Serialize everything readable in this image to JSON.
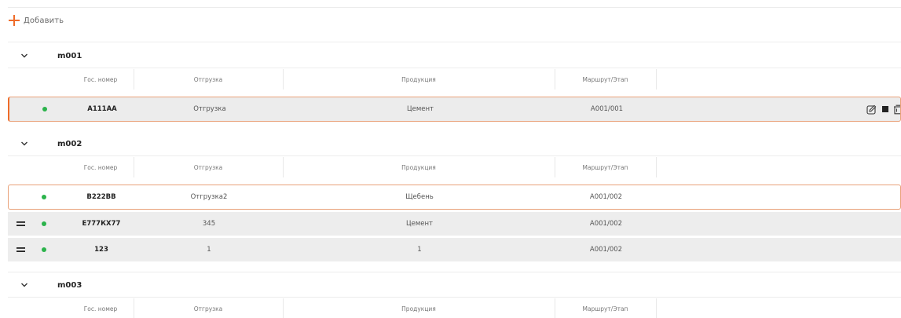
{
  "toolbar": {
    "add_label": "Добавить",
    "accent_color": "#ef6c2a"
  },
  "columns": [
    "Гос. номер",
    "Отгрузка",
    "Продукция",
    "Маршрут/Этап"
  ],
  "groups": [
    {
      "name": "m001",
      "rows": [
        {
          "plate": "А111АА",
          "shipment": "Отгрузка",
          "product": "Цемент",
          "route": "A001/001",
          "status": "green"
        }
      ]
    },
    {
      "name": "m002",
      "rows": [
        {
          "plate": "В222ВВ",
          "shipment": "Отгрузка2",
          "product": "Щебень",
          "route": "A001/002",
          "status": "green"
        },
        {
          "plate": "Е777КХ77",
          "shipment": "345",
          "product": "Цемент",
          "route": "A001/002",
          "status": "green"
        },
        {
          "plate": "123",
          "shipment": "1",
          "product": "1",
          "route": "A001/002",
          "status": "green"
        }
      ]
    },
    {
      "name": "m003",
      "rows": []
    }
  ],
  "icons": {
    "add": "plus-icon",
    "collapse": "chevron-down-icon",
    "drag": "drag-handle-icon",
    "edit": "edit-icon",
    "stop": "stop-icon",
    "delete": "trash-icon",
    "status": "status-dot-icon"
  },
  "status_color": "#2bb34b"
}
